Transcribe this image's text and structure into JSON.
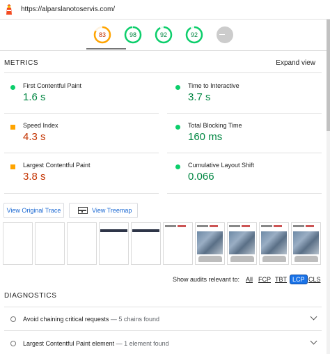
{
  "header": {
    "url": "https://alparslanotoservis.com/"
  },
  "gauges": [
    {
      "score": "83",
      "color": "#ffa400",
      "text_color": "#c33300",
      "track": "#fff3e0",
      "fill": 0.83
    },
    {
      "score": "98",
      "color": "#0cce6b",
      "text_color": "#018642",
      "track": "#e5faef",
      "fill": 0.98
    },
    {
      "score": "92",
      "color": "#0cce6b",
      "text_color": "#018642",
      "track": "#e5faef",
      "fill": 0.92
    },
    {
      "score": "92",
      "color": "#0cce6b",
      "text_color": "#018642",
      "track": "#e5faef",
      "fill": 0.92
    },
    {
      "score": "",
      "color": "#cccccc",
      "text_color": "#999999",
      "track": "#cccccc",
      "fill": 1.0
    }
  ],
  "metrics": {
    "title": "METRICS",
    "expand_label": "Expand view",
    "items": [
      {
        "label": "First Contentful Paint",
        "value": "1.6 s",
        "status": "pass"
      },
      {
        "label": "Time to Interactive",
        "value": "3.7 s",
        "status": "pass"
      },
      {
        "label": "Speed Index",
        "value": "4.3 s",
        "status": "average"
      },
      {
        "label": "Total Blocking Time",
        "value": "160 ms",
        "status": "pass"
      },
      {
        "label": "Largest Contentful Paint",
        "value": "3.8 s",
        "status": "average"
      },
      {
        "label": "Cumulative Layout Shift",
        "value": "0.066",
        "status": "pass"
      }
    ]
  },
  "buttons": {
    "view_trace": "View Original Trace",
    "view_treemap": "View Treemap"
  },
  "filmstrip": {
    "frames": [
      "blank",
      "blank",
      "blank",
      "header",
      "header",
      "logo",
      "photo",
      "photo",
      "photo",
      "photo"
    ]
  },
  "filter": {
    "label": "Show audits relevant to:",
    "options": [
      "All",
      "FCP",
      "TBT",
      "LCP",
      "CLS"
    ],
    "selected": "LCP"
  },
  "diagnostics": {
    "title": "DIAGNOSTICS",
    "audits": [
      {
        "title": "Avoid chaining critical requests",
        "detail": "— 5 chains found"
      },
      {
        "title": "Largest Contentful Paint element",
        "detail": "— 1 element found"
      }
    ]
  },
  "colors": {
    "pass": "#018642",
    "average": "#c33300",
    "accent": "#1a73e8"
  }
}
